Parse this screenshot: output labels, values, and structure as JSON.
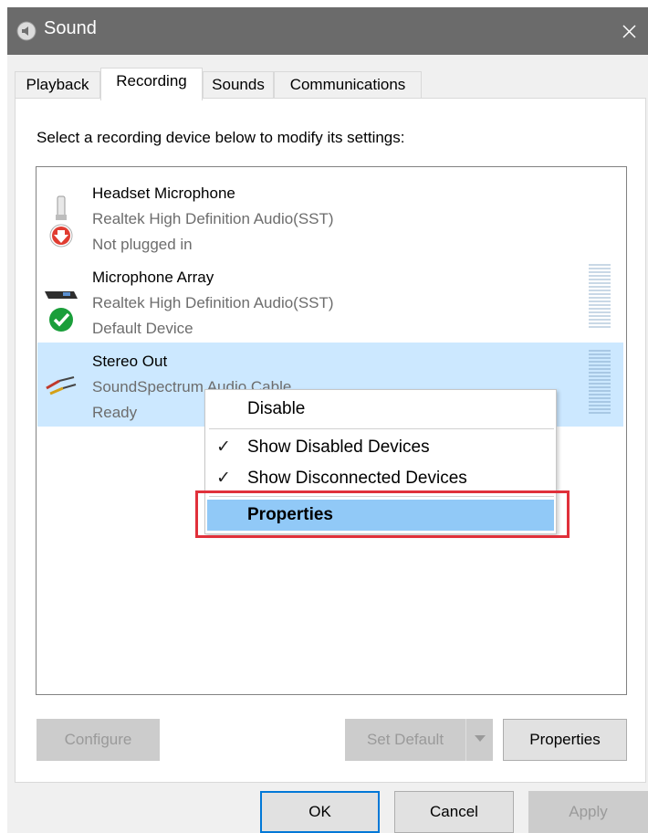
{
  "window": {
    "title": "Sound",
    "icon": "speaker-icon",
    "close_glyph": "✕"
  },
  "tabs": [
    {
      "label": "Playback",
      "active": false
    },
    {
      "label": "Recording",
      "active": true
    },
    {
      "label": "Sounds",
      "active": false
    },
    {
      "label": "Communications",
      "active": false
    }
  ],
  "instruction": "Select a recording device below to modify its settings:",
  "devices": [
    {
      "name": "Headset Microphone",
      "driver": "Realtek High Definition Audio(SST)",
      "status": "Not plugged in",
      "icon": "headset-microphone-icon",
      "badge": "red-down-arrow-badge",
      "selected": false,
      "level_meter": false
    },
    {
      "name": "Microphone Array",
      "driver": "Realtek High Definition Audio(SST)",
      "status": "Default Device",
      "icon": "microphone-array-icon",
      "badge": "green-check-badge",
      "selected": false,
      "level_meter": true
    },
    {
      "name": "Stereo Out",
      "driver": "SoundSpectrum Audio Cable",
      "status": "Ready",
      "icon": "audio-cable-icon",
      "selected": true,
      "level_meter": true
    }
  ],
  "context_menu": {
    "items": [
      {
        "label": "Disable",
        "checked": false
      },
      {
        "label": "Show Disabled Devices",
        "checked": true
      },
      {
        "label": "Show Disconnected Devices",
        "checked": true
      },
      {
        "label": "Properties",
        "checked": false,
        "highlighted": true
      }
    ],
    "check_glyph": "✓"
  },
  "buttons": {
    "configure": "Configure",
    "set_default": "Set Default",
    "properties": "Properties",
    "ok": "OK",
    "cancel": "Cancel",
    "apply": "Apply"
  },
  "colors": {
    "selection": "#cce8ff",
    "menu_highlight": "#91c9f7",
    "annotation_red": "#e0303a",
    "default_button_border": "#0078d7"
  }
}
